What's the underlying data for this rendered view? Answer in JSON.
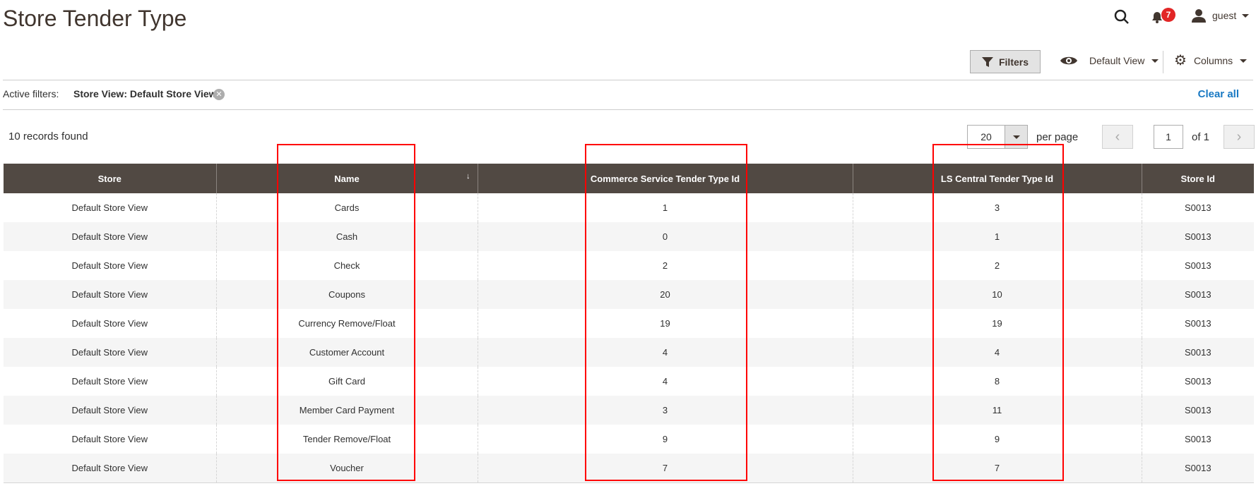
{
  "page_title": "Store Tender Type",
  "header": {
    "notifications_count": "7",
    "user": "guest"
  },
  "toolbar": {
    "filters": "Filters",
    "view": "Default View",
    "columns": "Columns"
  },
  "active_filters": {
    "label": "Active filters:",
    "filter": "Store View: Default Store View",
    "clear_all": "Clear all"
  },
  "pager": {
    "records": "10 records found",
    "per_page_value": "20",
    "per_page_label": "per page",
    "page": "1",
    "of": "of 1"
  },
  "table": {
    "columns": [
      "Store",
      "Name",
      "Commerce Service Tender Type Id",
      "LS Central Tender Type Id",
      "Store Id"
    ],
    "rows": [
      [
        "Default Store View",
        "Cards",
        "1",
        "3",
        "S0013"
      ],
      [
        "Default Store View",
        "Cash",
        "0",
        "1",
        "S0013"
      ],
      [
        "Default Store View",
        "Check",
        "2",
        "2",
        "S0013"
      ],
      [
        "Default Store View",
        "Coupons",
        "20",
        "10",
        "S0013"
      ],
      [
        "Default Store View",
        "Currency Remove/Float",
        "19",
        "19",
        "S0013"
      ],
      [
        "Default Store View",
        "Customer Account",
        "4",
        "4",
        "S0013"
      ],
      [
        "Default Store View",
        "Gift Card",
        "4",
        "8",
        "S0013"
      ],
      [
        "Default Store View",
        "Member Card Payment",
        "3",
        "11",
        "S0013"
      ],
      [
        "Default Store View",
        "Tender Remove/Float",
        "9",
        "9",
        "S0013"
      ],
      [
        "Default Store View",
        "Voucher",
        "7",
        "7",
        "S0013"
      ]
    ]
  }
}
